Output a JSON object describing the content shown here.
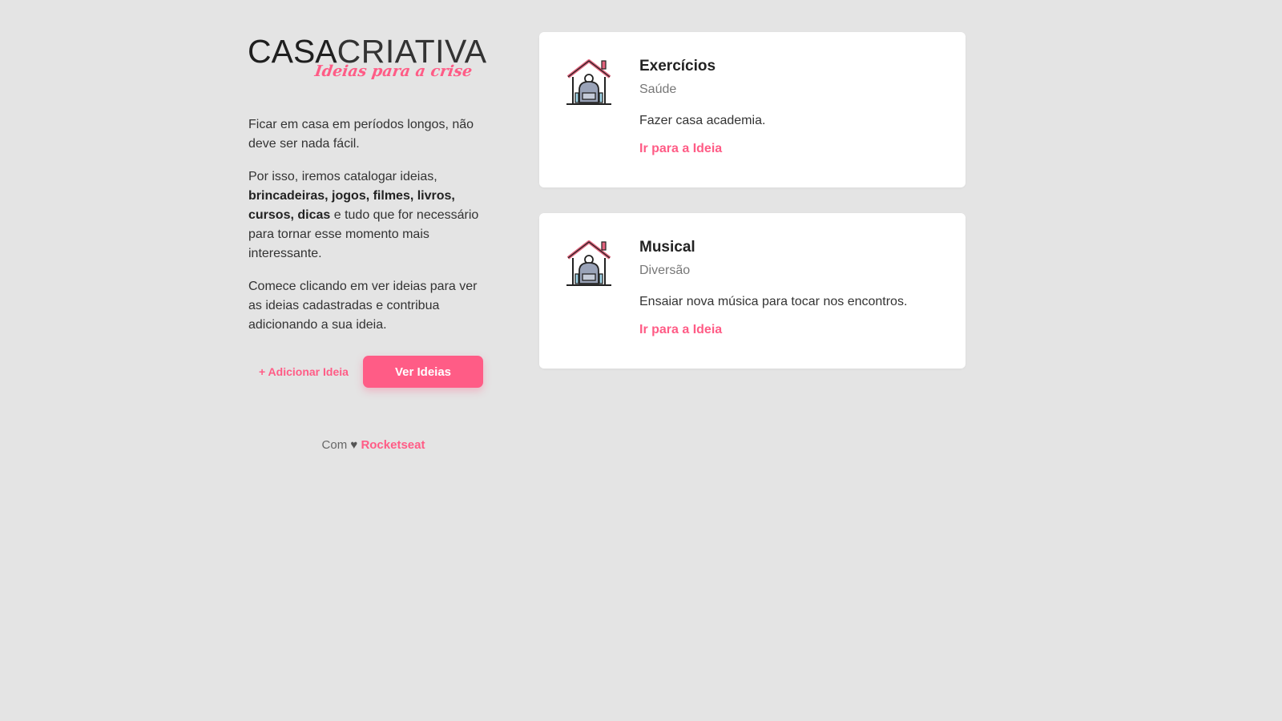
{
  "logo": {
    "main_bold": "CASA",
    "main_light": "CRIATIVA",
    "tagline": "Ideias para a crise"
  },
  "intro": {
    "p1": "Ficar em casa em períodos longos, não deve ser nada fácil.",
    "p2_start": "Por isso, iremos catalogar ideias, ",
    "p2_bold": "brincadeiras, jogos, filmes, livros, cursos, dicas",
    "p2_end": " e tudo que for necessário para tornar esse momento mais interessante.",
    "p3": "Comece clicando em ver ideias para ver as ideias cadastradas e contribua adicionando a sua ideia."
  },
  "actions": {
    "add_label": "+ Adicionar Ideia",
    "view_label": "Ver Ideias"
  },
  "footer": {
    "prefix": "Com",
    "heart": "♥",
    "link": "Rocketseat"
  },
  "ideas": [
    {
      "title": "Exercícios",
      "category": "Saúde",
      "description": "Fazer casa academia.",
      "link": "Ir para a Ideia",
      "icon": "home-gym-icon"
    },
    {
      "title": "Musical",
      "category": "Diversão",
      "description": "Ensaiar nova música para tocar nos encontros.",
      "link": "Ir para a Ideia",
      "icon": "home-gym-icon"
    }
  ],
  "colors": {
    "accent": "#ff5c86",
    "background": "#e4e4e4",
    "card": "#ffffff"
  }
}
